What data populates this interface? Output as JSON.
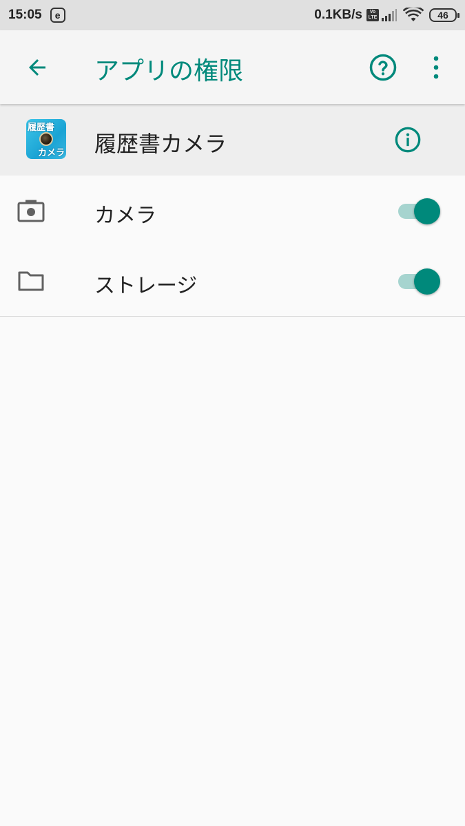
{
  "status_bar": {
    "time": "15:05",
    "notification_icon": "e",
    "speed": "0.1KB/s",
    "volte_top": "Vo",
    "volte_bottom": "LTE",
    "battery": "46"
  },
  "app_bar": {
    "title": "アプリの権限",
    "back_icon": "arrow-back-icon",
    "help_icon": "help-circle-icon",
    "more_icon": "more-vert-icon"
  },
  "app_info": {
    "name": "履歴書カメラ",
    "icon_text_top": "履歴書",
    "icon_text_bottom": "カメラ",
    "info_icon": "info-circle-icon"
  },
  "permissions": [
    {
      "label": "カメラ",
      "icon": "camera-icon",
      "enabled": true
    },
    {
      "label": "ストレージ",
      "icon": "folder-icon",
      "enabled": true
    }
  ],
  "colors": {
    "accent": "#00897b",
    "track": "#a6d4cf",
    "status_bar": "#e0e0e0",
    "app_bar": "#f5f5f5",
    "app_row": "#eeeeee",
    "background": "#fafafa"
  }
}
